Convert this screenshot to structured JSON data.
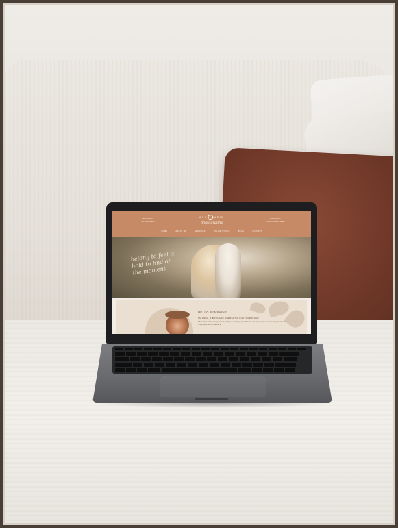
{
  "scene": "laptop-on-sofa",
  "colors": {
    "outer_border": "#4a3f36",
    "sofa": "#ebe7e1",
    "pillow_brown": "#7a3e2d",
    "site_header": "#c68b66"
  },
  "website": {
    "header": {
      "left_text": "WEDDING\nWISCONSIN",
      "logo_name": "ANNA  MARIE",
      "logo_script": "photography",
      "right_text": "WEDDING\nPHOTOGRAPHER"
    },
    "nav": [
      "HOME",
      "ABOUT ME",
      "SERVICES",
      "ONLINE STUDIO",
      "BLOG",
      "CONTACT"
    ],
    "hero_script": "belong to feel it hold to find of the moment",
    "about": {
      "title": "HELLO SUNSHINE",
      "subtitle": "I'M ANNA, A BOLD AND ENERGETIC PHOTOGRAPHER",
      "body": "When she's not wandering around reading or watching a good film she and capturing the best out of my friends and family. Let's Bee it, meaning a"
    }
  }
}
